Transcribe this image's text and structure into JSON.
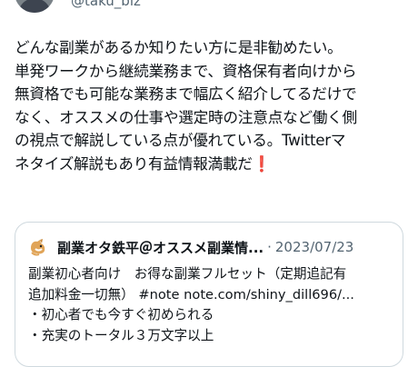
{
  "author": {
    "handle": "@taku_biz"
  },
  "tweet": {
    "lines": [
      "どんな副業があるか知りたい方に是非勧めたい。",
      "単発ワークから継続業務まで、資格保有者向けから",
      "無資格でも可能な業務まで幅広く紹介してるだけで",
      "なく、オススメの仕事や選定時の注意点など働く側",
      "の視点で解説している点が優れている。Twitterマ",
      "ネタイズ解説もあり有益情報満載だ"
    ],
    "end_emoji": "❗"
  },
  "quote": {
    "author_name": "副業オタ鉄平＠オススメ副業情...",
    "separator": "·",
    "date": "2023/07/23",
    "lines": [
      "副業初心者向け　お得な副業フルセット（定期追記有",
      "追加料金一切無） #note note.com/shiny_dill696/...",
      "・初心者でも今すぐ初められる",
      "・充実のトータル３万文字以上"
    ]
  },
  "colors": {
    "text": "#0f1419",
    "secondary": "#536471",
    "border": "#cfd9de",
    "emoji_red": "#d9222a"
  },
  "icons": {
    "avatar": "user-photo-avatar",
    "quote_avatar": "dog-avatar-icon"
  }
}
